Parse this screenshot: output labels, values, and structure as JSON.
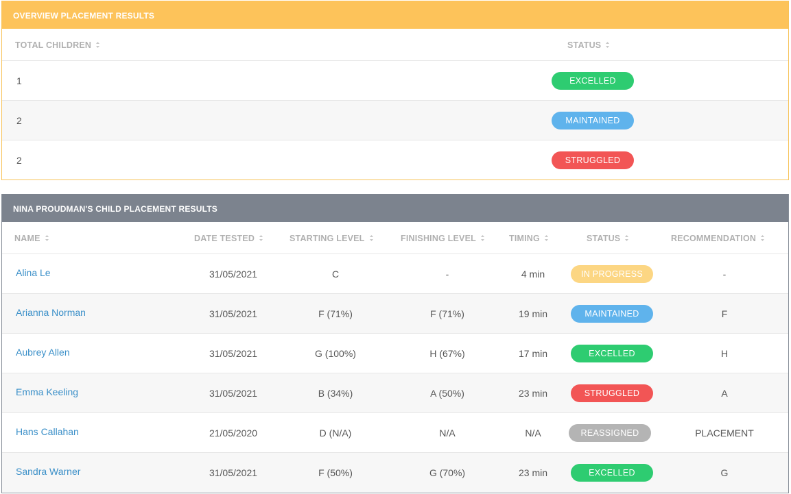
{
  "colors": {
    "overview_header": "#fdc35a",
    "child_header": "#7c838e",
    "excelled": "#2ecc71",
    "maintained": "#5fb3ec",
    "struggled": "#f25555",
    "in_progress": "#fcd683",
    "reassigned": "#b4b4b4",
    "link": "#3a8fc8"
  },
  "overview": {
    "title": "OVERVIEW PLACEMENT RESULTS",
    "columns": {
      "total": "TOTAL CHILDREN",
      "status": "STATUS"
    },
    "rows": [
      {
        "total": "1",
        "status": "EXCELLED",
        "status_key": "excelled"
      },
      {
        "total": "2",
        "status": "MAINTAINED",
        "status_key": "maintained"
      },
      {
        "total": "2",
        "status": "STRUGGLED",
        "status_key": "struggled"
      }
    ]
  },
  "child_results": {
    "title": "NINA PROUDMAN'S CHILD PLACEMENT RESULTS",
    "columns": {
      "name": "NAME",
      "date": "DATE TESTED",
      "start": "STARTING LEVEL",
      "finish": "FINISHING LEVEL",
      "timing": "TIMING",
      "status": "STATUS",
      "rec": "RECOMMENDATION"
    },
    "rows": [
      {
        "name": "Alina Le",
        "date": "31/05/2021",
        "start": "C",
        "finish": "-",
        "timing": "4 min",
        "status": "IN PROGRESS",
        "status_key": "in_progress",
        "rec": "-"
      },
      {
        "name": "Arianna Norman",
        "date": "31/05/2021",
        "start": "F (71%)",
        "finish": "F (71%)",
        "timing": "19 min",
        "status": "MAINTAINED",
        "status_key": "maintained",
        "rec": "F"
      },
      {
        "name": "Aubrey Allen",
        "date": "31/05/2021",
        "start": "G (100%)",
        "finish": "H (67%)",
        "timing": "17 min",
        "status": "EXCELLED",
        "status_key": "excelled",
        "rec": "H"
      },
      {
        "name": "Emma Keeling",
        "date": "31/05/2021",
        "start": "B (34%)",
        "finish": "A (50%)",
        "timing": "23 min",
        "status": "STRUGGLED",
        "status_key": "struggled",
        "rec": "A"
      },
      {
        "name": "Hans Callahan",
        "date": "21/05/2020",
        "start": "D (N/A)",
        "finish": "N/A",
        "timing": "N/A",
        "status": "REASSIGNED",
        "status_key": "reassigned",
        "rec": "PLACEMENT"
      },
      {
        "name": "Sandra Warner",
        "date": "31/05/2021",
        "start": "F (50%)",
        "finish": "G (70%)",
        "timing": "23 min",
        "status": "EXCELLED",
        "status_key": "excelled",
        "rec": "G"
      }
    ]
  }
}
